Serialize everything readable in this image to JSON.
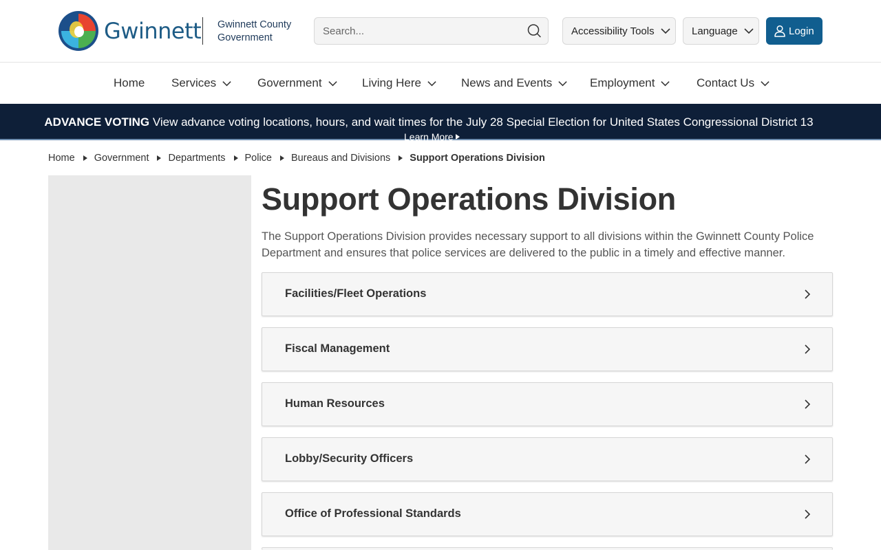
{
  "header": {
    "brand": "Gwinnett",
    "brand_sub_line1": "Gwinnett County",
    "brand_sub_line2": "Government",
    "search_placeholder": "Search...",
    "accessibility_label": "Accessibility Tools",
    "language_label": "Language",
    "login_label": "Login"
  },
  "colors": {
    "primary": "#115e8f",
    "alert_bg": "#0e1f38",
    "brand_text": "#1e5c86"
  },
  "nav": {
    "items": [
      {
        "label": "Home",
        "has_dropdown": false
      },
      {
        "label": "Services",
        "has_dropdown": true
      },
      {
        "label": "Government",
        "has_dropdown": true
      },
      {
        "label": "Living Here",
        "has_dropdown": true
      },
      {
        "label": "News and Events",
        "has_dropdown": true
      },
      {
        "label": "Employment",
        "has_dropdown": true
      },
      {
        "label": "Contact Us",
        "has_dropdown": true
      }
    ]
  },
  "alert": {
    "strong": "ADVANCE VOTING",
    "text": "View advance voting locations, hours, and wait times for the July 28 Special Election for United States Congressional District 13",
    "link": "Learn More"
  },
  "breadcrumb": {
    "items": [
      "Home",
      "Government",
      "Departments",
      "Police",
      "Bureaus and Divisions",
      "Support Operations Division"
    ]
  },
  "main": {
    "title": "Support Operations Division",
    "intro": "The Support Operations Division provides necessary support to all divisions within the Gwinnett County Police Department and ensures that police services are delivered to the public in a timely and effective manner.",
    "accordions": [
      "Facilities/Fleet Operations",
      "Fiscal Management",
      "Human Resources",
      "Lobby/Security Officers",
      "Office of Professional Standards"
    ]
  }
}
